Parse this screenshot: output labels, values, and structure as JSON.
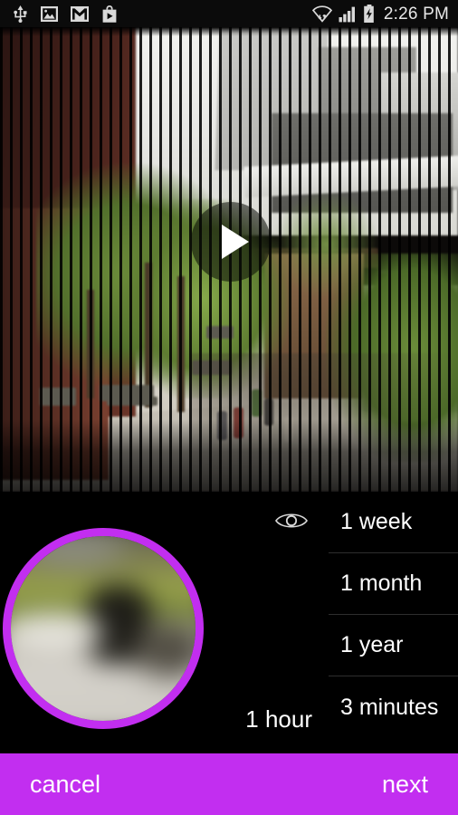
{
  "status_bar": {
    "time": "2:26 PM",
    "left_icons": [
      {
        "name": "usb-icon",
        "label": "USB connected"
      },
      {
        "name": "image-icon",
        "label": "Screenshot captured"
      },
      {
        "name": "gmail-icon",
        "label": "Gmail"
      },
      {
        "name": "play-store-icon",
        "label": "Play Store"
      }
    ],
    "right_icons": [
      {
        "name": "wifi-icon",
        "label": "Wi-Fi"
      },
      {
        "name": "cellular-signal-icon",
        "label": "Signal"
      },
      {
        "name": "battery-charging-icon",
        "label": "Battery charging"
      }
    ]
  },
  "video": {
    "play_label": "play",
    "scene_description": "Outdoor urban plaza seen through vertical blinds"
  },
  "chooser": {
    "visibility_icon": "eye-icon",
    "current_value": "1 hour",
    "options": [
      {
        "label": "1 week"
      },
      {
        "label": "1 month"
      },
      {
        "label": "1 year"
      },
      {
        "label": "3 minutes"
      }
    ]
  },
  "action_bar": {
    "cancel_label": "cancel",
    "next_label": "next"
  },
  "colors": {
    "accent": "#c22ef0",
    "background": "#000000",
    "text": "#ffffff",
    "status_bar_bg": "#0b0b0b",
    "divider": "#2e2e2e"
  }
}
